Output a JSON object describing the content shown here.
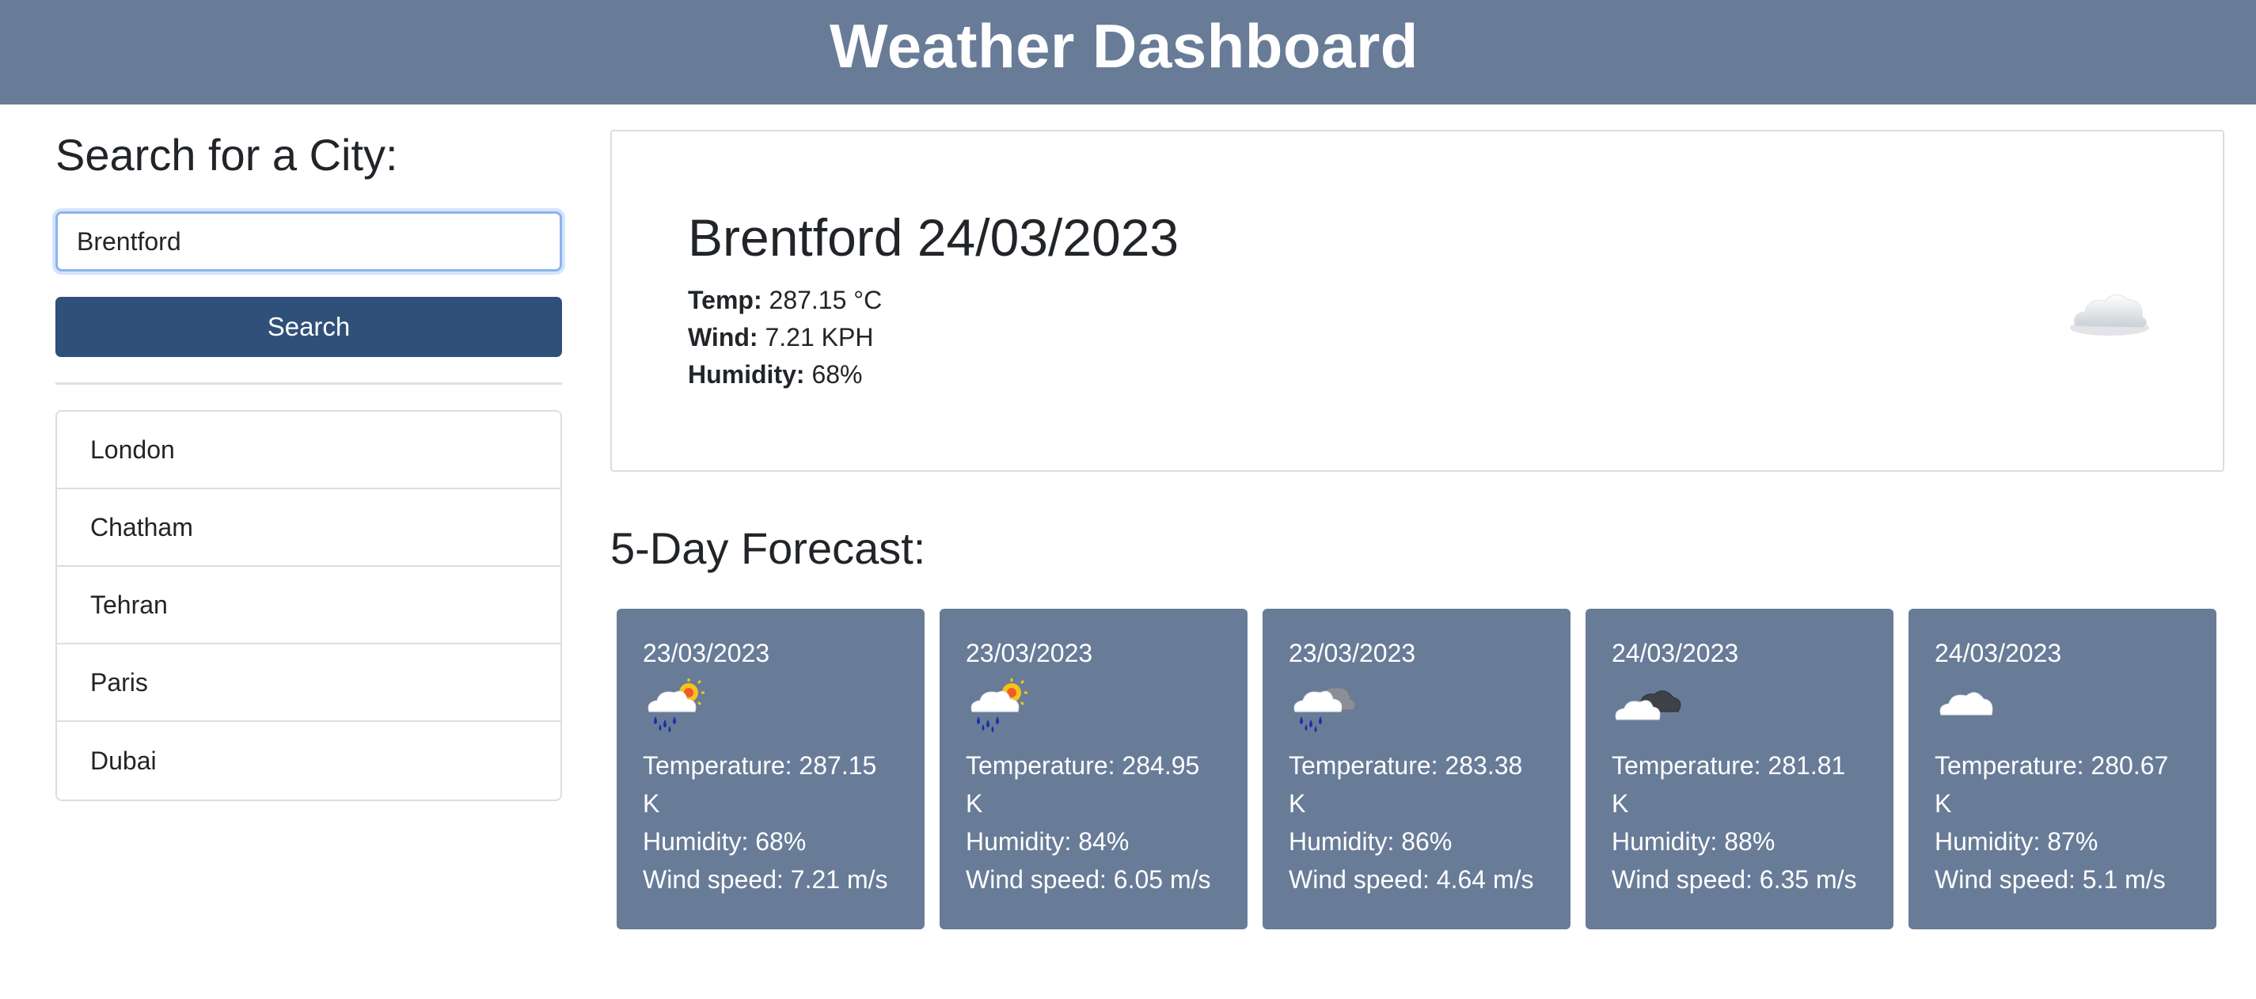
{
  "header": {
    "title": "Weather Dashboard"
  },
  "sidebar": {
    "heading": "Search for a City:",
    "search_value": "Brentford",
    "search_button": "Search",
    "history": [
      "London",
      "Chatham",
      "Tehran",
      "Paris",
      "Dubai"
    ]
  },
  "current": {
    "title": "Brentford 24/03/2023",
    "temp_label": "Temp:",
    "temp_value": "287.15 °C",
    "wind_label": "Wind:",
    "wind_value": "7.21 KPH",
    "humidity_label": "Humidity:",
    "humidity_value": "68%",
    "icon": "cloud-icon"
  },
  "forecast": {
    "title": "5-Day Forecast:",
    "days": [
      {
        "date": "23/03/2023",
        "icon": "rain-sun-icon",
        "temperature": "Temperature: 287.15 K",
        "humidity": "Humidity: 68%",
        "wind": "Wind speed: 7.21 m/s"
      },
      {
        "date": "23/03/2023",
        "icon": "rain-sun-icon",
        "temperature": "Temperature: 284.95 K",
        "humidity": "Humidity: 84%",
        "wind": "Wind speed: 6.05 m/s"
      },
      {
        "date": "23/03/2023",
        "icon": "rain-cloud-icon",
        "temperature": "Temperature: 283.38 K",
        "humidity": "Humidity: 86%",
        "wind": "Wind speed: 4.64 m/s"
      },
      {
        "date": "24/03/2023",
        "icon": "overcast-clouds-icon",
        "temperature": "Temperature: 281.81 K",
        "humidity": "Humidity: 88%",
        "wind": "Wind speed: 6.35 m/s"
      },
      {
        "date": "24/03/2023",
        "icon": "cloud-icon",
        "temperature": "Temperature: 280.67 K",
        "humidity": "Humidity: 87%",
        "wind": "Wind speed: 5.1 m/s"
      }
    ]
  },
  "colors": {
    "header_bg": "#687c98",
    "button_bg": "#2f5079",
    "card_bg": "#687c98"
  }
}
